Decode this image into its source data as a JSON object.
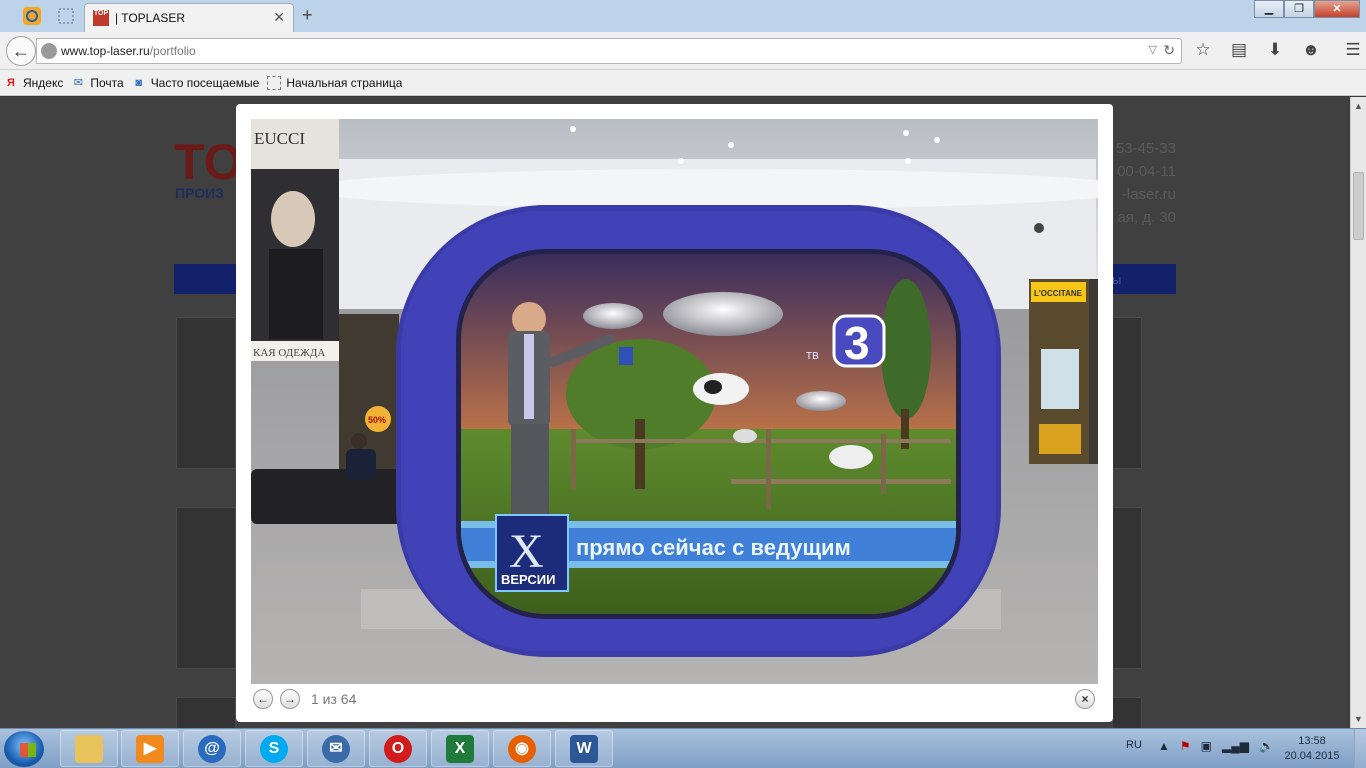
{
  "browser": {
    "tab_title": "| TOPLASER",
    "tab_favicon_text": "TOP",
    "url_domain": "www.top-laser.ru",
    "url_path": "/portfolio",
    "bookmarks": [
      "Яндекс",
      "Почта",
      "Часто посещаемые",
      "Начальная страница"
    ]
  },
  "page": {
    "logo": "TO",
    "logo_sub": "ПРОИЗ",
    "contacts": [
      "53-45-33",
      "00-04-11",
      "-laser.ru",
      "ая, д. 30"
    ],
    "menu_right": "ы"
  },
  "lightbox": {
    "counter": "1 из 64",
    "prev_glyph": "←",
    "next_glyph": "→",
    "close_glyph": "×",
    "photo": {
      "store_sign": "EUCCI",
      "store_banner": "КАЯ ОДЕЖДА",
      "sale_badge": "50%",
      "shop_sign": "L'OCCITANE",
      "channel_logo_prefix": "тв",
      "channel_logo_number": "3",
      "show_logo_letter": "X",
      "show_logo_word": "ВЕРСИИ",
      "ticker": "прямо сейчас с ведущим"
    }
  },
  "taskbar": {
    "language": "RU",
    "time": "13:58",
    "date": "20.04.2015"
  }
}
